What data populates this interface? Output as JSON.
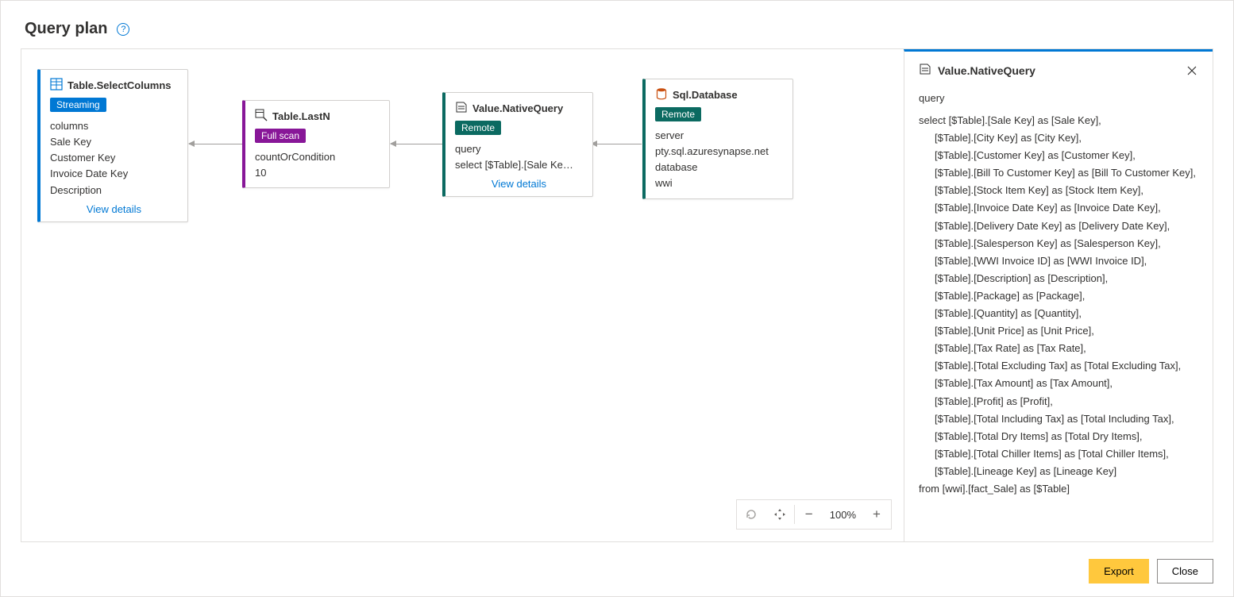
{
  "header": {
    "title": "Query plan"
  },
  "nodes": {
    "selectColumns": {
      "title": "Table.SelectColumns",
      "badge": "Streaming",
      "label1": "columns",
      "row1": "Sale Key",
      "row2": "Customer Key",
      "row3": "Invoice Date Key",
      "row4": "Description",
      "link": "View details"
    },
    "lastN": {
      "title": "Table.LastN",
      "badge": "Full scan",
      "label1": "countOrCondition",
      "row1": "10"
    },
    "nativeQuery": {
      "title": "Value.NativeQuery",
      "badge": "Remote",
      "label1": "query",
      "row1": "select [$Table].[Sale Ke…",
      "link": "View details"
    },
    "sqlDb": {
      "title": "Sql.Database",
      "badge": "Remote",
      "label1": "server",
      "row1": "pty.sql.azuresynapse.net",
      "label2": "database",
      "row2": "wwi"
    }
  },
  "detail": {
    "title": "Value.NativeQuery",
    "section_label": "query",
    "lines": [
      "select [$Table].[Sale Key] as [Sale Key],",
      "    [$Table].[City Key] as [City Key],",
      "    [$Table].[Customer Key] as [Customer Key],",
      "    [$Table].[Bill To Customer Key] as [Bill To Customer Key],",
      "    [$Table].[Stock Item Key] as [Stock Item Key],",
      "    [$Table].[Invoice Date Key] as [Invoice Date Key],",
      "    [$Table].[Delivery Date Key] as [Delivery Date Key],",
      "    [$Table].[Salesperson Key] as [Salesperson Key],",
      "    [$Table].[WWI Invoice ID] as [WWI Invoice ID],",
      "    [$Table].[Description] as [Description],",
      "    [$Table].[Package] as [Package],",
      "    [$Table].[Quantity] as [Quantity],",
      "    [$Table].[Unit Price] as [Unit Price],",
      "    [$Table].[Tax Rate] as [Tax Rate],",
      "    [$Table].[Total Excluding Tax] as [Total Excluding Tax],",
      "    [$Table].[Tax Amount] as [Tax Amount],",
      "    [$Table].[Profit] as [Profit],",
      "    [$Table].[Total Including Tax] as [Total Including Tax],",
      "    [$Table].[Total Dry Items] as [Total Dry Items],",
      "    [$Table].[Total Chiller Items] as [Total Chiller Items],",
      "    [$Table].[Lineage Key] as [Lineage Key]",
      "from [wwi].[fact_Sale] as [$Table]"
    ]
  },
  "zoom": {
    "level": "100%"
  },
  "footer": {
    "export": "Export",
    "close": "Close"
  }
}
